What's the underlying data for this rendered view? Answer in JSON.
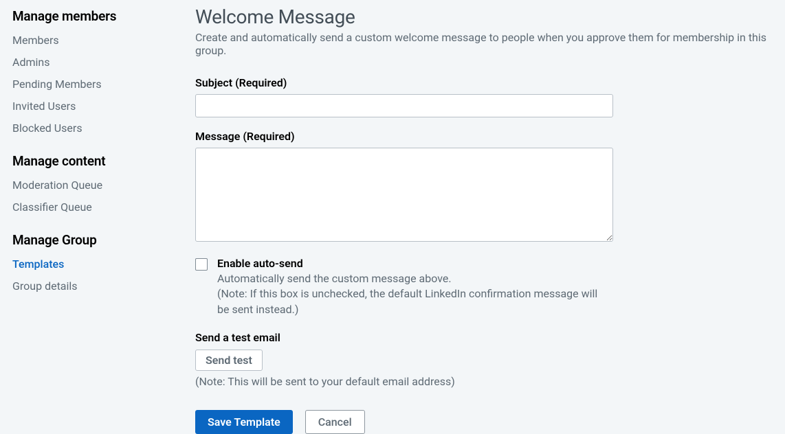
{
  "sidebar": {
    "sections": [
      {
        "heading": "Manage members",
        "items": [
          {
            "label": "Members",
            "active": false
          },
          {
            "label": "Admins",
            "active": false
          },
          {
            "label": "Pending Members",
            "active": false
          },
          {
            "label": "Invited Users",
            "active": false
          },
          {
            "label": "Blocked Users",
            "active": false
          }
        ]
      },
      {
        "heading": "Manage content",
        "items": [
          {
            "label": "Moderation Queue",
            "active": false
          },
          {
            "label": "Classifier Queue",
            "active": false
          }
        ]
      },
      {
        "heading": "Manage Group",
        "items": [
          {
            "label": "Templates",
            "active": true
          },
          {
            "label": "Group details",
            "active": false
          }
        ]
      }
    ]
  },
  "main": {
    "title": "Welcome Message",
    "subtitle": "Create and automatically send a custom welcome message to people when you approve them for membership in this group.",
    "subject_label": "Subject (Required)",
    "subject_value": "",
    "message_label": "Message (Required)",
    "message_value": "",
    "autosend": {
      "checked": false,
      "title": "Enable auto-send",
      "description": "Automatically send the custom message above.",
      "note": "(Note: If this box is unchecked, the default LinkedIn confirmation message will be sent instead.)"
    },
    "test": {
      "heading": "Send a test email",
      "button": "Send test",
      "note": "(Note: This will be sent to your default email address)"
    },
    "actions": {
      "save": "Save Template",
      "cancel": "Cancel"
    }
  }
}
